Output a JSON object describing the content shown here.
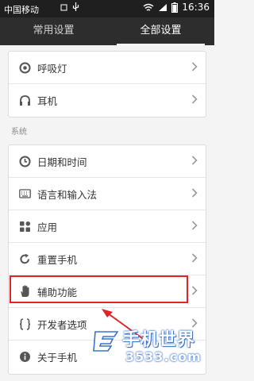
{
  "status_bar": {
    "carrier": "中国移动",
    "time": "16:36",
    "icons": [
      "sim-icon",
      "usb-icon",
      "wifi-icon",
      "signal-icon",
      "battery-icon"
    ]
  },
  "tabs": [
    {
      "label": "常用设置",
      "active": false
    },
    {
      "label": "全部设置",
      "active": true
    }
  ],
  "group1": {
    "items": [
      {
        "label": "呼吸灯",
        "icon": "notification-light-icon"
      },
      {
        "label": "耳机",
        "icon": "headphones-icon"
      }
    ]
  },
  "system_section": {
    "title": "系统",
    "items": [
      {
        "label": "日期和时间",
        "icon": "clock-icon"
      },
      {
        "label": "语言和输入法",
        "icon": "keyboard-icon"
      },
      {
        "label": "应用",
        "icon": "apps-icon"
      },
      {
        "label": "重置手机",
        "icon": "reset-icon"
      },
      {
        "label": "辅助功能",
        "icon": "hand-icon"
      },
      {
        "label": "开发者选项",
        "icon": "braces-icon"
      },
      {
        "label": "关于手机",
        "icon": "info-icon"
      }
    ]
  },
  "annotation": {
    "highlight_color": "#e1242a",
    "highlighted_item": "辅助功能"
  },
  "watermark": {
    "title": "手机世界",
    "number": "3533.com",
    "color": "#3b73c8"
  }
}
